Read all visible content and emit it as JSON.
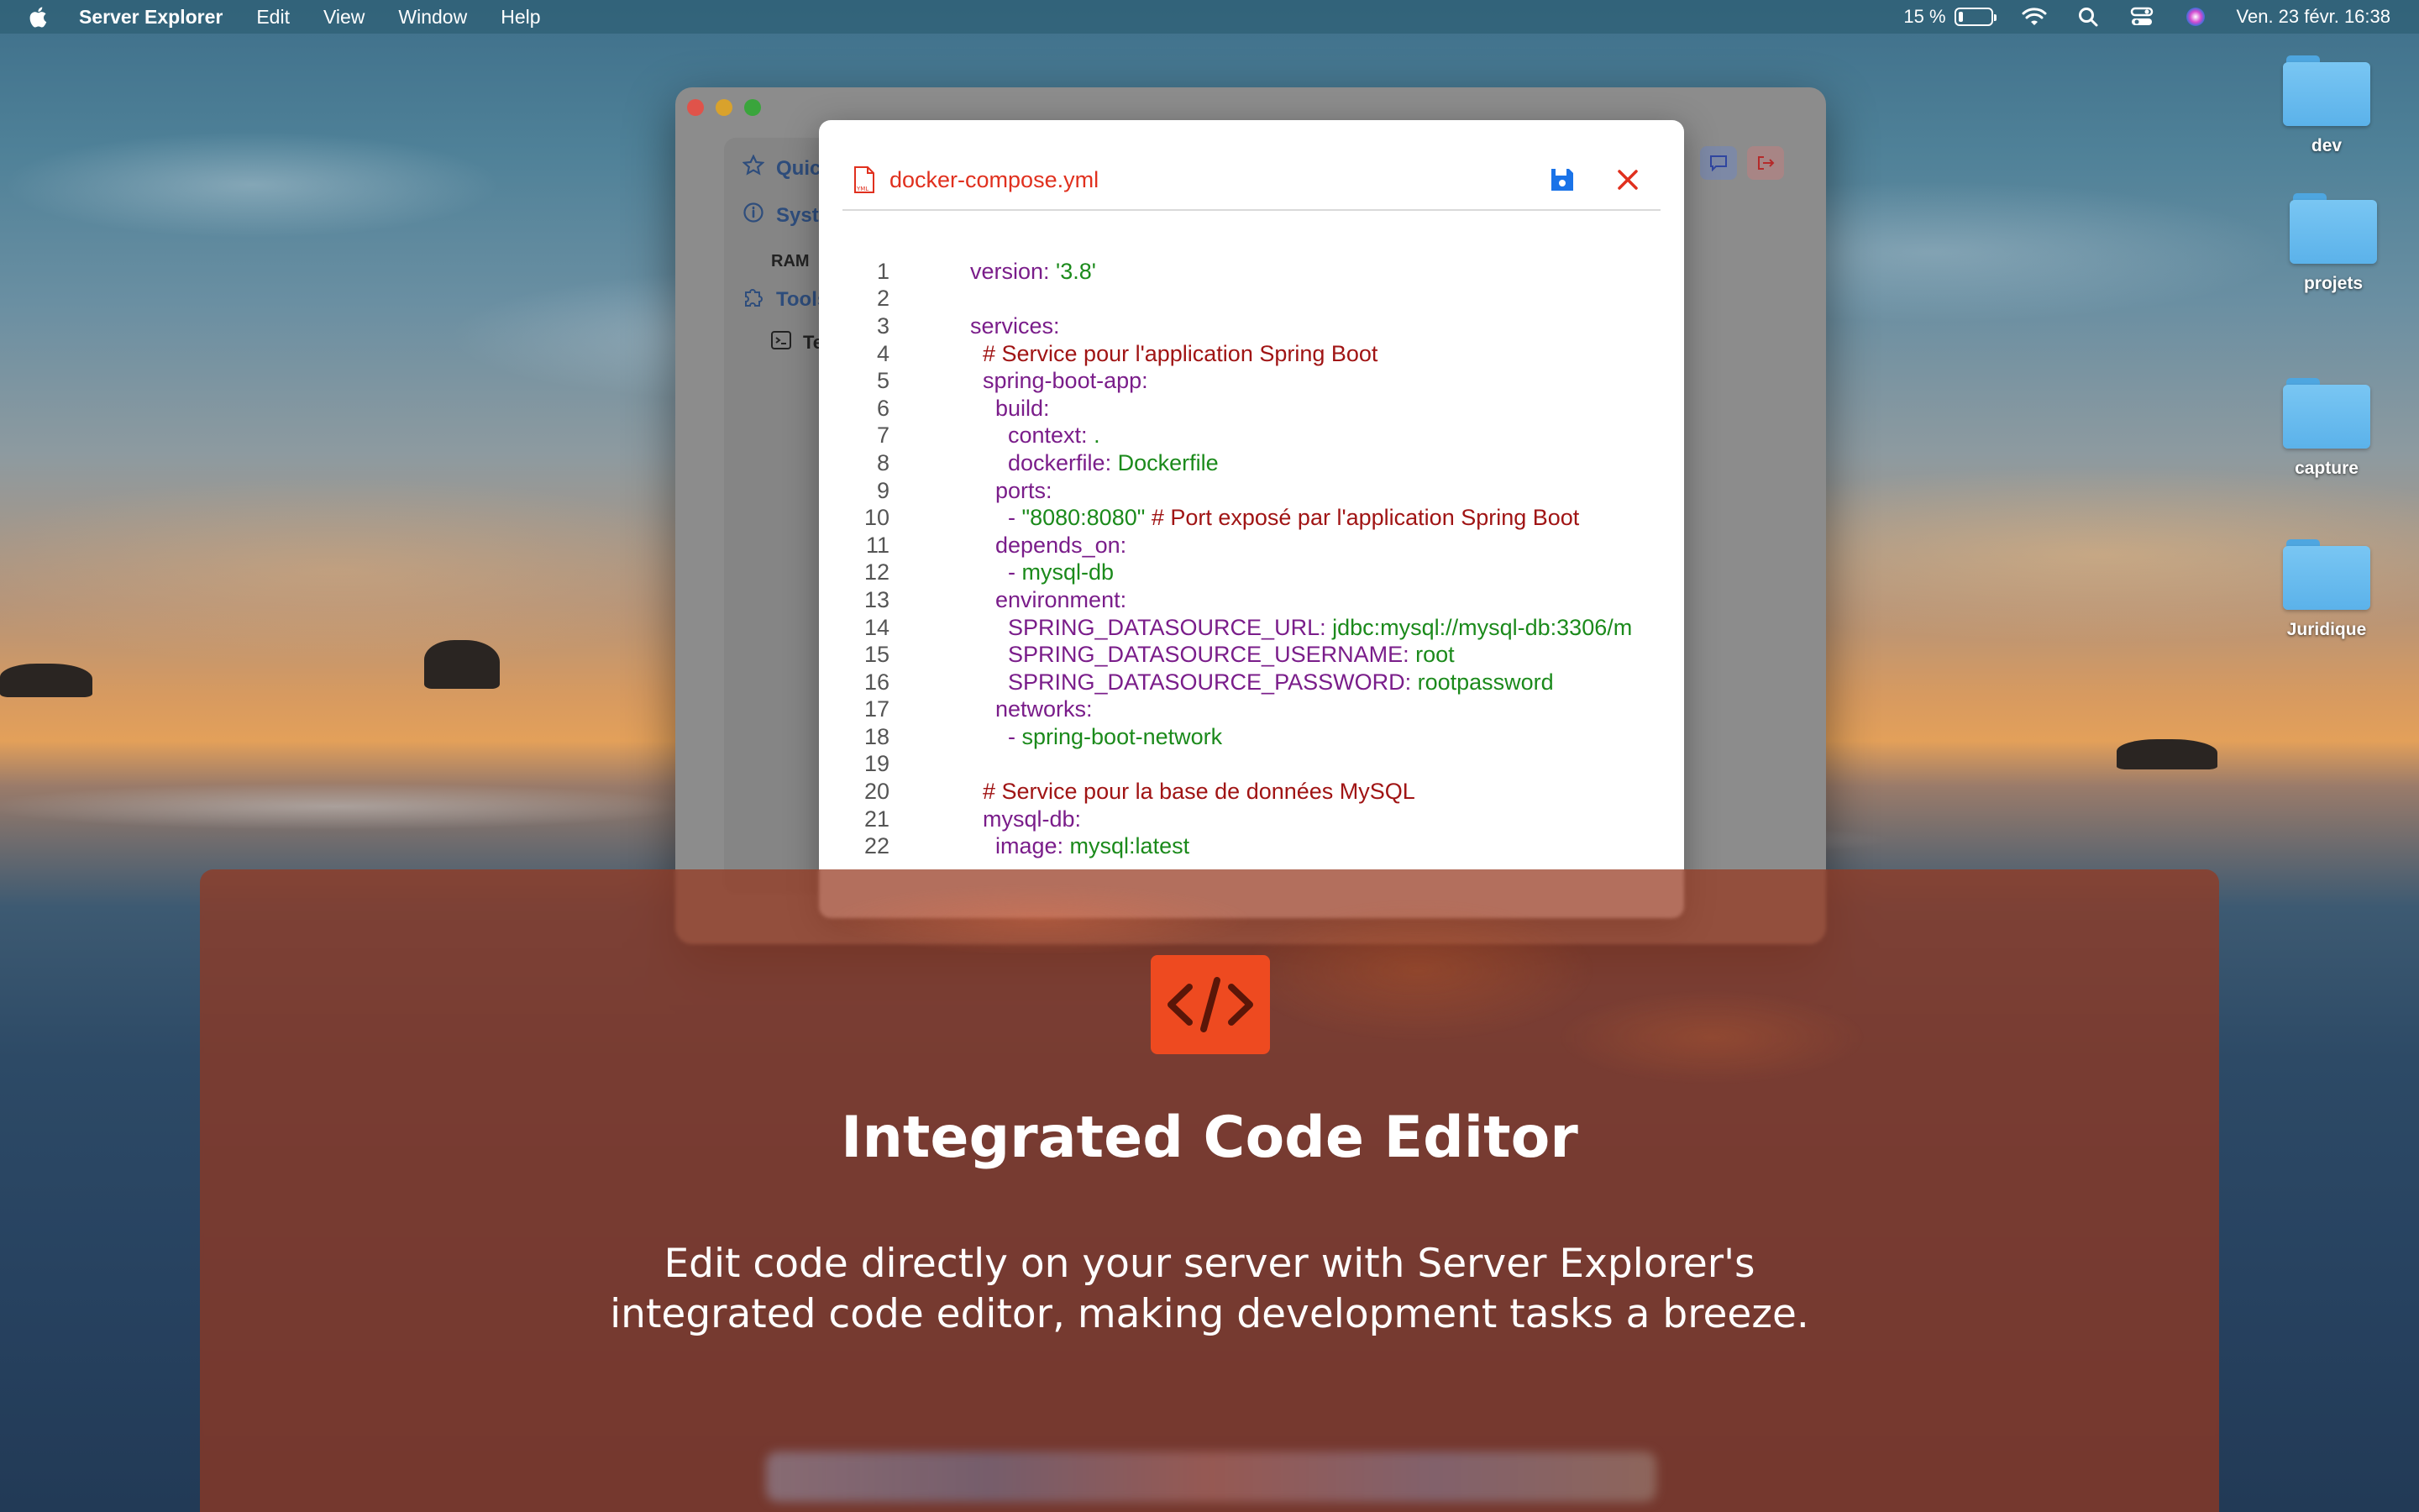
{
  "menubar": {
    "app_name": "Server Explorer",
    "items": [
      "Edit",
      "View",
      "Window",
      "Help"
    ],
    "battery": "15 %",
    "datetime": "Ven. 23 févr. 16:38"
  },
  "desktop": {
    "icons": [
      {
        "label": "dev"
      },
      {
        "label": "projets"
      },
      {
        "label": "capture"
      },
      {
        "label": "Juridique"
      }
    ]
  },
  "background_window": {
    "sidebar": {
      "quick_label": "Quic",
      "system_label": "Syst",
      "ram_label": "RAM",
      "tools_label": "Tools",
      "terminal_label": "Te"
    }
  },
  "editor": {
    "file_name": "docker-compose.yml",
    "lines": [
      {
        "n": "1",
        "parts": [
          {
            "t": "version: ",
            "c": "k"
          },
          {
            "t": "'3.8'",
            "c": "v"
          }
        ]
      },
      {
        "n": "2",
        "parts": []
      },
      {
        "n": "3",
        "parts": [
          {
            "t": "services:",
            "c": "k"
          }
        ]
      },
      {
        "n": "4",
        "parts": [
          {
            "t": "  # Service pour l'application Spring Boot",
            "c": "c"
          }
        ]
      },
      {
        "n": "5",
        "parts": [
          {
            "t": "  spring-boot-app:",
            "c": "k"
          }
        ]
      },
      {
        "n": "6",
        "parts": [
          {
            "t": "    build:",
            "c": "k"
          }
        ]
      },
      {
        "n": "7",
        "parts": [
          {
            "t": "      context: ",
            "c": "k"
          },
          {
            "t": ".",
            "c": "v"
          }
        ]
      },
      {
        "n": "8",
        "parts": [
          {
            "t": "      dockerfile: ",
            "c": "k"
          },
          {
            "t": "Dockerfile",
            "c": "v"
          }
        ]
      },
      {
        "n": "9",
        "parts": [
          {
            "t": "    ports:",
            "c": "k"
          }
        ]
      },
      {
        "n": "10",
        "parts": [
          {
            "t": "      - ",
            "c": "k"
          },
          {
            "t": "\"8080:8080\"",
            "c": "v"
          },
          {
            "t": " # Port exposé par l'application Spring Boot",
            "c": "c"
          }
        ]
      },
      {
        "n": "11",
        "parts": [
          {
            "t": "    depends_on:",
            "c": "k"
          }
        ]
      },
      {
        "n": "12",
        "parts": [
          {
            "t": "      - ",
            "c": "k"
          },
          {
            "t": "mysql-db",
            "c": "v"
          }
        ]
      },
      {
        "n": "13",
        "parts": [
          {
            "t": "    environment:",
            "c": "k"
          }
        ]
      },
      {
        "n": "14",
        "parts": [
          {
            "t": "      SPRING_DATASOURCE_URL: ",
            "c": "k"
          },
          {
            "t": "jdbc:mysql://mysql-db:3306/m",
            "c": "v"
          }
        ]
      },
      {
        "n": "15",
        "parts": [
          {
            "t": "      SPRING_DATASOURCE_USERNAME: ",
            "c": "k"
          },
          {
            "t": "root",
            "c": "v"
          }
        ]
      },
      {
        "n": "16",
        "parts": [
          {
            "t": "      SPRING_DATASOURCE_PASSWORD: ",
            "c": "k"
          },
          {
            "t": "rootpassword",
            "c": "v"
          }
        ]
      },
      {
        "n": "17",
        "parts": [
          {
            "t": "    networks:",
            "c": "k"
          }
        ]
      },
      {
        "n": "18",
        "parts": [
          {
            "t": "      - ",
            "c": "k"
          },
          {
            "t": "spring-boot-network",
            "c": "v"
          }
        ]
      },
      {
        "n": "19",
        "parts": []
      },
      {
        "n": "20",
        "parts": [
          {
            "t": "  # Service pour la base de données MySQL",
            "c": "c"
          }
        ]
      },
      {
        "n": "21",
        "parts": [
          {
            "t": "  mysql-db:",
            "c": "k"
          }
        ]
      },
      {
        "n": "22",
        "parts": [
          {
            "t": "    image: ",
            "c": "k"
          },
          {
            "t": "mysql:latest",
            "c": "v"
          }
        ]
      }
    ]
  },
  "promo": {
    "title": "Integrated Code Editor",
    "description_line1": "Edit code directly on your server with Server Explorer's",
    "description_line2": "integrated code editor, making development tasks a breeze."
  },
  "colors": {
    "accent_red": "#e0301e",
    "save_blue": "#1a73e8",
    "promo_icon": "#ee4a20"
  }
}
